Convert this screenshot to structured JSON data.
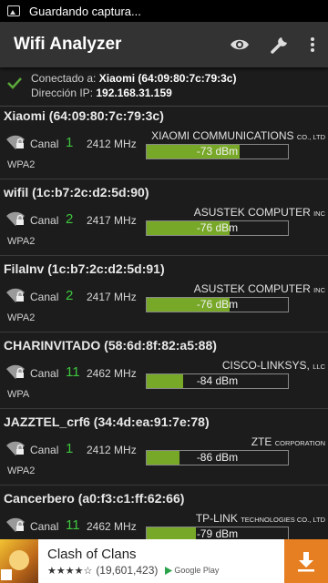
{
  "status_bar": {
    "notification_text": "Guardando captura..."
  },
  "app_bar": {
    "title": "Wifi Analyzer",
    "actions": [
      "eye-icon",
      "wrench-icon",
      "overflow-menu-icon"
    ]
  },
  "connection": {
    "connected_label": "Conectado a:",
    "connected_value": "Xiaomi (64:09:80:7c:79:3c)",
    "ip_label": "Dirección IP:",
    "ip_value": "192.168.31.159"
  },
  "canal_label": "Canal",
  "networks": [
    {
      "ssid": "Xiaomi (64:09:80:7c:79:3c)",
      "channel": "1",
      "freq": "2412 MHz",
      "vendor": "XIAOMI COMMUNICATIONS",
      "vendor_suffix": "CO., LTD",
      "dbm": "-73 dBm",
      "signal_fraction": 0.66,
      "security": "WPA2"
    },
    {
      "ssid": "wifil (1c:b7:2c:d2:5d:90)",
      "channel": "2",
      "freq": "2417 MHz",
      "vendor": "ASUSTEK COMPUTER",
      "vendor_suffix": "INC",
      "dbm": "-76 dBm",
      "signal_fraction": 0.59,
      "security": "WPA2"
    },
    {
      "ssid": "FilaInv (1c:b7:2c:d2:5d:91)",
      "channel": "2",
      "freq": "2417 MHz",
      "vendor": "ASUSTEK COMPUTER",
      "vendor_suffix": "INC",
      "dbm": "-76 dBm",
      "signal_fraction": 0.59,
      "security": "WPA2"
    },
    {
      "ssid": "CHARINVITADO (58:6d:8f:82:a5:88)",
      "channel": "11",
      "freq": "2462 MHz",
      "vendor": "CISCO-LINKSYS,",
      "vendor_suffix": "LLC",
      "dbm": "-84 dBm",
      "signal_fraction": 0.26,
      "security": "WPA"
    },
    {
      "ssid": "JAZZTEL_crf6 (34:4d:ea:91:7e:78)",
      "channel": "1",
      "freq": "2412 MHz",
      "vendor": "ZTE",
      "vendor_suffix": "CORPORATION",
      "dbm": "-86 dBm",
      "signal_fraction": 0.23,
      "security": "WPA2"
    },
    {
      "ssid": "Cancerbero (a0:f3:c1:ff:62:66)",
      "channel": "11",
      "freq": "2462 MHz",
      "vendor": "TP-LINK",
      "vendor_suffix": "TECHNOLOGIES CO., LTD",
      "dbm": "-79 dBm",
      "signal_fraction": 0.35,
      "security": ""
    }
  ],
  "ad": {
    "title": "Clash of Clans",
    "rating_stars": "★★★★☆",
    "reviews": "(19,601,423)",
    "store": "Google Play"
  },
  "colors": {
    "signal_bar": "#78a828",
    "channel_text": "#3ec63e",
    "ad_download": "#e67e22"
  }
}
